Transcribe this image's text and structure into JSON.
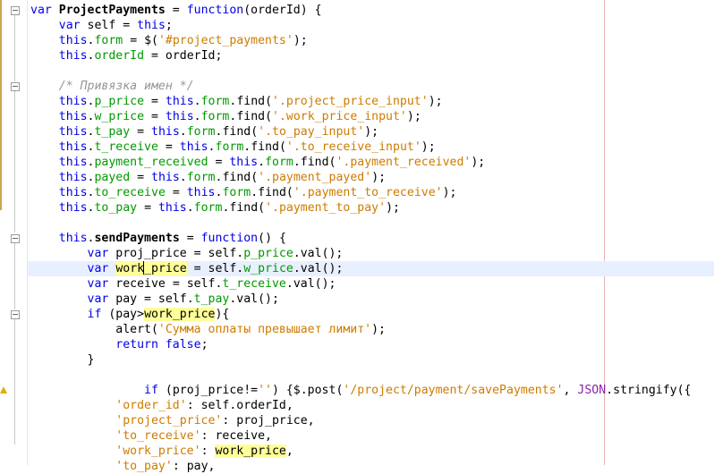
{
  "editor": {
    "language": "javascript",
    "highlighted_variable": "work_price",
    "current_line": 18,
    "lines": [
      [
        {
          "t": "kw",
          "v": "var "
        },
        {
          "t": "fn",
          "v": "ProjectPayments"
        },
        {
          "t": "",
          "v": " = "
        },
        {
          "t": "kw",
          "v": "function"
        },
        {
          "t": "",
          "v": "(orderId) {"
        }
      ],
      [
        {
          "t": "",
          "v": "    "
        },
        {
          "t": "kw",
          "v": "var"
        },
        {
          "t": "",
          "v": " self = "
        },
        {
          "t": "kw",
          "v": "this"
        },
        {
          "t": "",
          "v": ";"
        }
      ],
      [
        {
          "t": "",
          "v": "    "
        },
        {
          "t": "kw",
          "v": "this"
        },
        {
          "t": "",
          "v": "."
        },
        {
          "t": "prop",
          "v": "form"
        },
        {
          "t": "",
          "v": " = $("
        },
        {
          "t": "str",
          "v": "'#project_payments'"
        },
        {
          "t": "",
          "v": ");"
        }
      ],
      [
        {
          "t": "",
          "v": "    "
        },
        {
          "t": "kw",
          "v": "this"
        },
        {
          "t": "",
          "v": "."
        },
        {
          "t": "prop",
          "v": "orderId"
        },
        {
          "t": "",
          "v": " = orderId;"
        }
      ],
      [
        {
          "t": "",
          "v": ""
        }
      ],
      [
        {
          "t": "",
          "v": "    "
        },
        {
          "t": "cmt",
          "v": "/* Привязка имен */"
        }
      ],
      [
        {
          "t": "",
          "v": "    "
        },
        {
          "t": "kw",
          "v": "this"
        },
        {
          "t": "",
          "v": "."
        },
        {
          "t": "prop",
          "v": "p_price"
        },
        {
          "t": "",
          "v": " = "
        },
        {
          "t": "kw",
          "v": "this"
        },
        {
          "t": "",
          "v": "."
        },
        {
          "t": "prop",
          "v": "form"
        },
        {
          "t": "",
          "v": ".find("
        },
        {
          "t": "str",
          "v": "'.project_price_input'"
        },
        {
          "t": "",
          "v": ");"
        }
      ],
      [
        {
          "t": "",
          "v": "    "
        },
        {
          "t": "kw",
          "v": "this"
        },
        {
          "t": "",
          "v": "."
        },
        {
          "t": "prop",
          "v": "w_price"
        },
        {
          "t": "",
          "v": " = "
        },
        {
          "t": "kw",
          "v": "this"
        },
        {
          "t": "",
          "v": "."
        },
        {
          "t": "prop",
          "v": "form"
        },
        {
          "t": "",
          "v": ".find("
        },
        {
          "t": "str",
          "v": "'.work_price_input'"
        },
        {
          "t": "",
          "v": ");"
        }
      ],
      [
        {
          "t": "",
          "v": "    "
        },
        {
          "t": "kw",
          "v": "this"
        },
        {
          "t": "",
          "v": "."
        },
        {
          "t": "prop",
          "v": "t_pay"
        },
        {
          "t": "",
          "v": " = "
        },
        {
          "t": "kw",
          "v": "this"
        },
        {
          "t": "",
          "v": "."
        },
        {
          "t": "prop",
          "v": "form"
        },
        {
          "t": "",
          "v": ".find("
        },
        {
          "t": "str",
          "v": "'.to_pay_input'"
        },
        {
          "t": "",
          "v": ");"
        }
      ],
      [
        {
          "t": "",
          "v": "    "
        },
        {
          "t": "kw",
          "v": "this"
        },
        {
          "t": "",
          "v": "."
        },
        {
          "t": "prop",
          "v": "t_receive"
        },
        {
          "t": "",
          "v": " = "
        },
        {
          "t": "kw",
          "v": "this"
        },
        {
          "t": "",
          "v": "."
        },
        {
          "t": "prop",
          "v": "form"
        },
        {
          "t": "",
          "v": ".find("
        },
        {
          "t": "str",
          "v": "'.to_receive_input'"
        },
        {
          "t": "",
          "v": ");"
        }
      ],
      [
        {
          "t": "",
          "v": "    "
        },
        {
          "t": "kw",
          "v": "this"
        },
        {
          "t": "",
          "v": "."
        },
        {
          "t": "prop",
          "v": "payment_received"
        },
        {
          "t": "",
          "v": " = "
        },
        {
          "t": "kw",
          "v": "this"
        },
        {
          "t": "",
          "v": "."
        },
        {
          "t": "prop",
          "v": "form"
        },
        {
          "t": "",
          "v": ".find("
        },
        {
          "t": "str",
          "v": "'.payment_received'"
        },
        {
          "t": "",
          "v": ");"
        }
      ],
      [
        {
          "t": "",
          "v": "    "
        },
        {
          "t": "kw",
          "v": "this"
        },
        {
          "t": "",
          "v": "."
        },
        {
          "t": "prop",
          "v": "payed"
        },
        {
          "t": "",
          "v": " = "
        },
        {
          "t": "kw",
          "v": "this"
        },
        {
          "t": "",
          "v": "."
        },
        {
          "t": "prop",
          "v": "form"
        },
        {
          "t": "",
          "v": ".find("
        },
        {
          "t": "str",
          "v": "'.payment_payed'"
        },
        {
          "t": "",
          "v": ");"
        }
      ],
      [
        {
          "t": "",
          "v": "    "
        },
        {
          "t": "kw",
          "v": "this"
        },
        {
          "t": "",
          "v": "."
        },
        {
          "t": "prop",
          "v": "to_receive"
        },
        {
          "t": "",
          "v": " = "
        },
        {
          "t": "kw",
          "v": "this"
        },
        {
          "t": "",
          "v": "."
        },
        {
          "t": "prop",
          "v": "form"
        },
        {
          "t": "",
          "v": ".find("
        },
        {
          "t": "str",
          "v": "'.payment_to_receive'"
        },
        {
          "t": "",
          "v": ");"
        }
      ],
      [
        {
          "t": "",
          "v": "    "
        },
        {
          "t": "kw",
          "v": "this"
        },
        {
          "t": "",
          "v": "."
        },
        {
          "t": "prop",
          "v": "to_pay"
        },
        {
          "t": "",
          "v": " = "
        },
        {
          "t": "kw",
          "v": "this"
        },
        {
          "t": "",
          "v": "."
        },
        {
          "t": "prop",
          "v": "form"
        },
        {
          "t": "",
          "v": ".find("
        },
        {
          "t": "str",
          "v": "'.payment_to_pay'"
        },
        {
          "t": "",
          "v": ");"
        }
      ],
      [
        {
          "t": "",
          "v": ""
        }
      ],
      [
        {
          "t": "",
          "v": "    "
        },
        {
          "t": "kw",
          "v": "this"
        },
        {
          "t": "",
          "v": "."
        },
        {
          "t": "fn",
          "v": "sendPayments"
        },
        {
          "t": "",
          "v": " = "
        },
        {
          "t": "kw",
          "v": "function"
        },
        {
          "t": "",
          "v": "() {"
        }
      ],
      [
        {
          "t": "",
          "v": "        "
        },
        {
          "t": "kw",
          "v": "var"
        },
        {
          "t": "",
          "v": " proj_price = self."
        },
        {
          "t": "prop",
          "v": "p_price"
        },
        {
          "t": "",
          "v": ".val();"
        }
      ],
      [
        {
          "t": "",
          "v": "        "
        },
        {
          "t": "kw",
          "v": "var"
        },
        {
          "t": "",
          "v": " "
        },
        {
          "t": "mark",
          "v": "work_price"
        },
        {
          "t": "",
          "v": " = self."
        },
        {
          "t": "prop",
          "v": "w_price"
        },
        {
          "t": "",
          "v": ".val();"
        }
      ],
      [
        {
          "t": "",
          "v": "        "
        },
        {
          "t": "kw",
          "v": "var"
        },
        {
          "t": "",
          "v": " receive = self."
        },
        {
          "t": "prop",
          "v": "t_receive"
        },
        {
          "t": "",
          "v": ".val();"
        }
      ],
      [
        {
          "t": "",
          "v": "        "
        },
        {
          "t": "kw",
          "v": "var"
        },
        {
          "t": "",
          "v": " pay = self."
        },
        {
          "t": "prop",
          "v": "t_pay"
        },
        {
          "t": "",
          "v": ".val();"
        }
      ],
      [
        {
          "t": "",
          "v": "        "
        },
        {
          "t": "kw",
          "v": "if"
        },
        {
          "t": "",
          "v": " (pay>"
        },
        {
          "t": "mark",
          "v": "work_price"
        },
        {
          "t": "",
          "v": "){"
        }
      ],
      [
        {
          "t": "",
          "v": "            alert("
        },
        {
          "t": "str",
          "v": "'Сумма оплаты превышает лимит'"
        },
        {
          "t": "",
          "v": ");"
        }
      ],
      [
        {
          "t": "",
          "v": "            "
        },
        {
          "t": "kw",
          "v": "return false"
        },
        {
          "t": "",
          "v": ";"
        }
      ],
      [
        {
          "t": "",
          "v": "        }"
        }
      ],
      [
        {
          "t": "",
          "v": ""
        }
      ],
      [
        {
          "t": "",
          "v": "                "
        },
        {
          "t": "kw",
          "v": "if"
        },
        {
          "t": "",
          "v": " (proj_price!="
        },
        {
          "t": "str",
          "v": "''"
        },
        {
          "t": "",
          "v": ") {$.post("
        },
        {
          "t": "str",
          "v": "'/project/payment/savePayments'"
        },
        {
          "t": "",
          "v": ", "
        },
        {
          "t": "json",
          "v": "JSON"
        },
        {
          "t": "",
          "v": ".stringify({"
        }
      ],
      [
        {
          "t": "",
          "v": "            "
        },
        {
          "t": "str",
          "v": "'order_id'"
        },
        {
          "t": "",
          "v": ": self.orderId,"
        }
      ],
      [
        {
          "t": "",
          "v": "            "
        },
        {
          "t": "str",
          "v": "'project_price'"
        },
        {
          "t": "",
          "v": ": proj_price,"
        }
      ],
      [
        {
          "t": "",
          "v": "            "
        },
        {
          "t": "str",
          "v": "'to_receive'"
        },
        {
          "t": "",
          "v": ": receive,"
        }
      ],
      [
        {
          "t": "",
          "v": "            "
        },
        {
          "t": "str",
          "v": "'work_price'"
        },
        {
          "t": "",
          "v": ": "
        },
        {
          "t": "mark",
          "v": "work_price"
        },
        {
          "t": "",
          "v": ","
        }
      ],
      [
        {
          "t": "",
          "v": "            "
        },
        {
          "t": "str",
          "v": "'to_pay'"
        },
        {
          "t": "",
          "v": ": pay,"
        }
      ]
    ]
  }
}
